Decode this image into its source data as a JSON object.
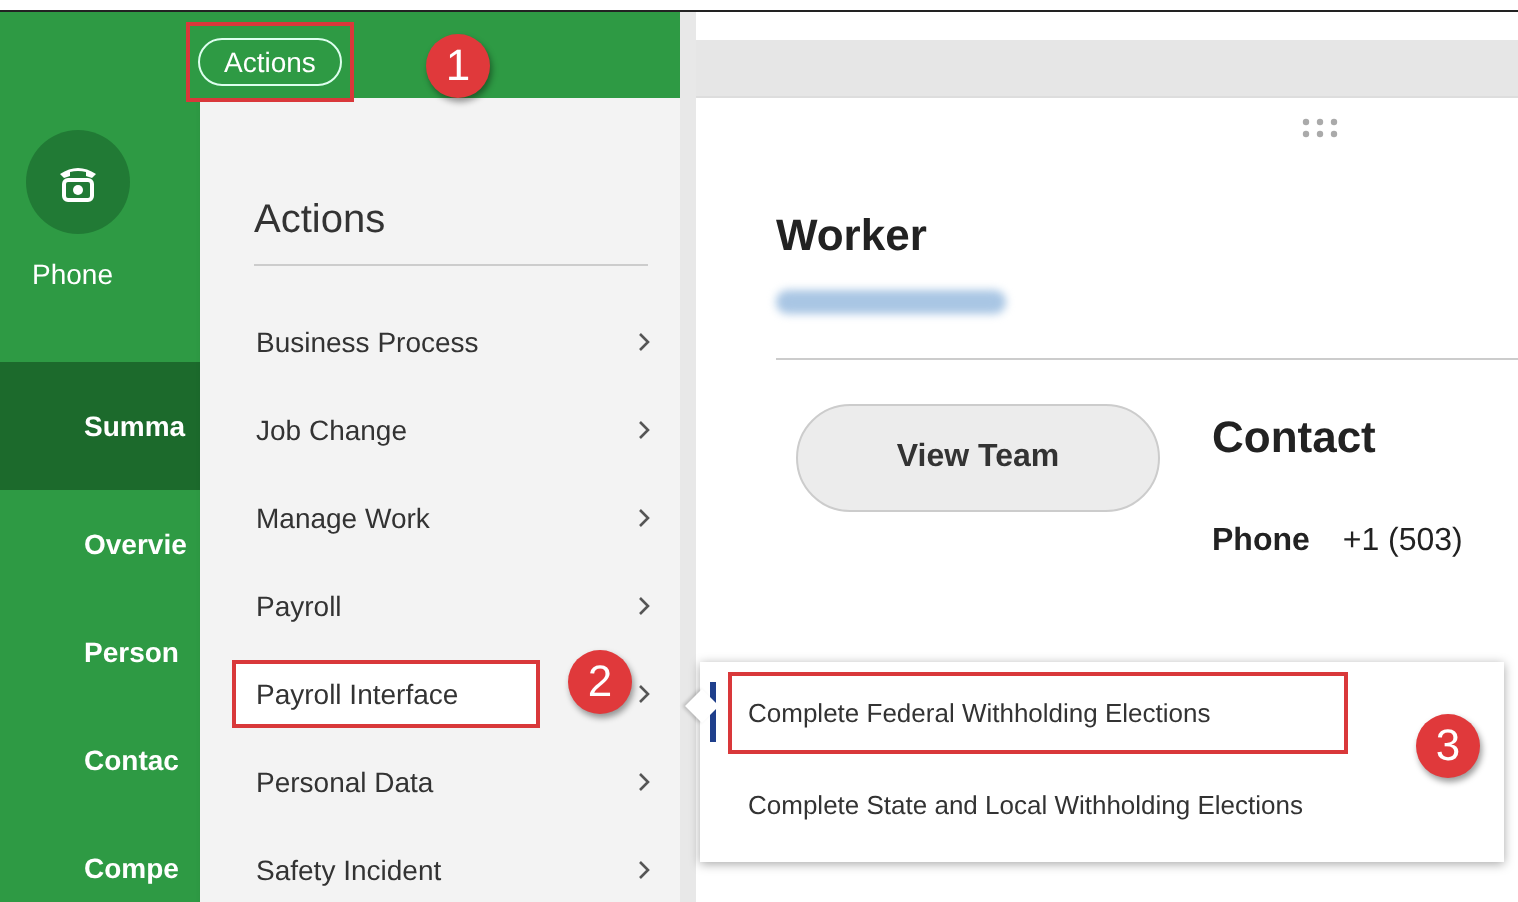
{
  "header": {
    "actions_button": {
      "label": "Actions",
      "highlighted": true,
      "callout": "1"
    }
  },
  "sidebar": {
    "phone": {
      "label": "Phone"
    },
    "items": [
      {
        "label": "Summa",
        "selected": true
      },
      {
        "label": "Overvie",
        "selected": false
      },
      {
        "label": "Person",
        "selected": false
      },
      {
        "label": "Contac",
        "selected": false
      },
      {
        "label": "Compe",
        "selected": false
      }
    ]
  },
  "actions_menu": {
    "title": "Actions",
    "items": [
      {
        "label": "Business Process",
        "highlighted": false
      },
      {
        "label": "Job Change",
        "highlighted": false
      },
      {
        "label": "Manage Work",
        "highlighted": false
      },
      {
        "label": "Payroll",
        "highlighted": false
      },
      {
        "label": "Payroll Interface",
        "highlighted": true,
        "callout": "2"
      },
      {
        "label": "Personal Data",
        "highlighted": false
      },
      {
        "label": "Safety Incident",
        "highlighted": false
      }
    ]
  },
  "submenu": {
    "callout": "3",
    "items": [
      {
        "label": "Complete Federal Withholding Elections",
        "selected": true,
        "highlighted": true
      },
      {
        "label": "Complete State and Local Withholding Elections",
        "selected": false,
        "highlighted": false
      }
    ]
  },
  "worker": {
    "title": "Worker",
    "view_team_button": "View Team"
  },
  "contact": {
    "title": "Contact",
    "phone_label": "Phone",
    "phone_value": "+1 (503)"
  }
}
